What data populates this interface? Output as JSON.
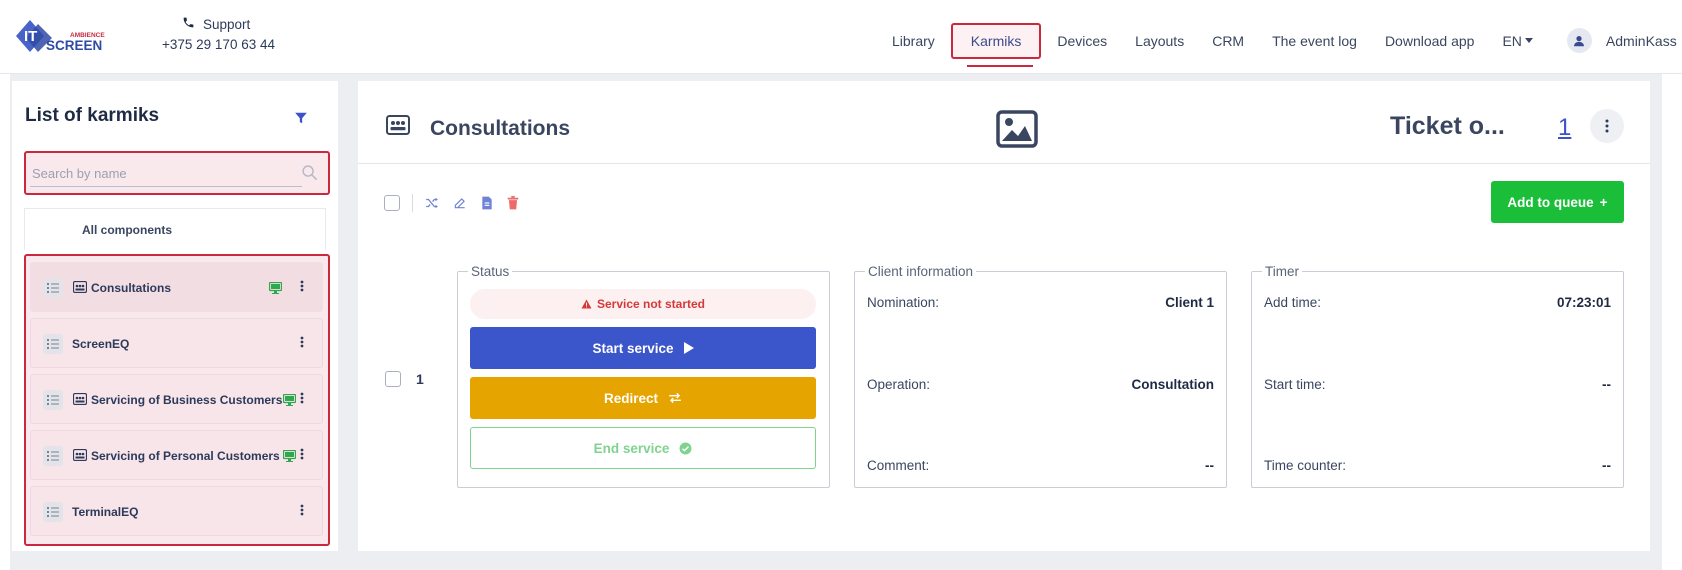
{
  "header": {
    "logo": {
      "it": "IT",
      "ambience": "AMBIENCE",
      "screen": "SCREEN"
    },
    "support_label": "Support",
    "support_phone": "+375 29 170 63 44",
    "nav": [
      "Library",
      "Karmiks",
      "Devices",
      "Layouts",
      "CRM",
      "The event log",
      "Download app"
    ],
    "active_nav": "Karmiks",
    "lang": "EN",
    "user": "AdminKass"
  },
  "sidebar": {
    "title": "List of karmiks",
    "search_placeholder": "Search by name",
    "all_components": "All components",
    "items": [
      {
        "label": "Consultations",
        "has_icon": true,
        "has_monitor": true,
        "selected": true
      },
      {
        "label": "ScreenEQ",
        "has_icon": false,
        "has_monitor": false,
        "selected": false
      },
      {
        "label": "Servicing of Business Customers",
        "has_icon": true,
        "has_monitor": true,
        "selected": false
      },
      {
        "label": "Servicing of Personal Customers",
        "has_icon": true,
        "has_monitor": true,
        "selected": false
      },
      {
        "label": "TerminalEQ",
        "has_icon": false,
        "has_monitor": false,
        "selected": false
      }
    ]
  },
  "main": {
    "title": "Consultations",
    "ticket_label": "Ticket o...",
    "ticket_count": "1",
    "add_queue": "Add to queue",
    "add_queue_icon": "+",
    "row_number": "1",
    "status": {
      "legend": "Status",
      "not_started": "Service not started",
      "start": "Start service",
      "redirect": "Redirect",
      "end": "End service"
    },
    "client": {
      "legend": "Client information",
      "nomination_label": "Nomination:",
      "nomination_value": "Client 1",
      "operation_label": "Operation:",
      "operation_value": "Consultation",
      "comment_label": "Comment:",
      "comment_value": "--"
    },
    "timer": {
      "legend": "Timer",
      "add_time_label": "Add time:",
      "add_time_value": "07:23:01",
      "start_time_label": "Start time:",
      "start_time_value": "--",
      "counter_label": "Time counter:",
      "counter_value": "--"
    }
  },
  "colors": {
    "accent_red": "#c9283d",
    "primary_blue": "#3b55cb",
    "redirect_yellow": "#e6a400",
    "success_green": "#1bbe38",
    "end_green": "#7fd38f",
    "monitor_green": "#2fa84f"
  }
}
